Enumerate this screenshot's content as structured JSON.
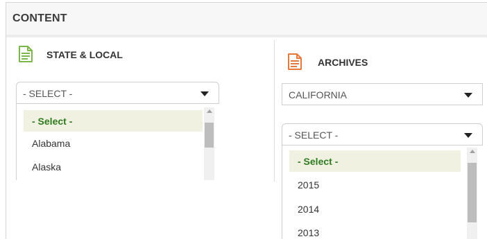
{
  "header": {
    "title": "CONTENT"
  },
  "state_local": {
    "title": "STATE & LOCAL",
    "icon": "document-icon",
    "icon_color": "#7ab648",
    "select": {
      "value": "- SELECT -"
    },
    "options": [
      "- Select -",
      "Alabama",
      "Alaska"
    ],
    "selected_index": 0
  },
  "archives": {
    "title": "ARCHIVES",
    "icon": "document-icon",
    "icon_color": "#e8773b",
    "region_select": {
      "value": "CALIFORNIA"
    },
    "year_select": {
      "value": "- SELECT -"
    },
    "options": [
      "- Select -",
      "2015",
      "2014",
      "2013"
    ],
    "selected_index": 0
  },
  "colors": {
    "selected_text": "#2e7a1f",
    "selected_bg": "#f1f1e2"
  }
}
